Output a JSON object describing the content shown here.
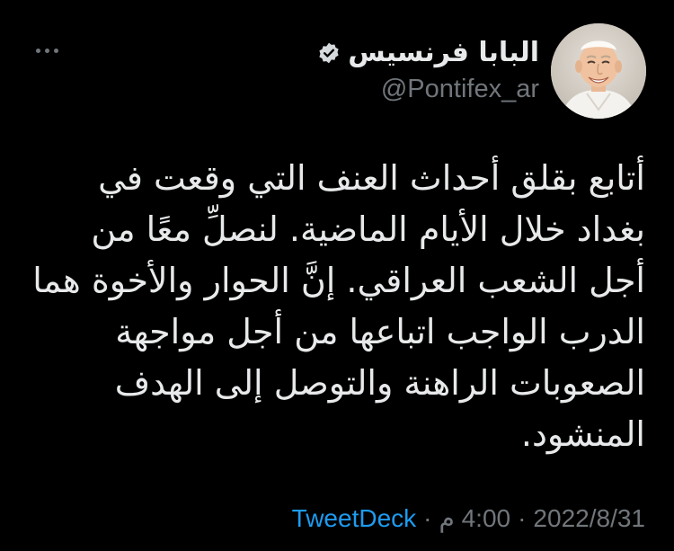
{
  "author": {
    "display_name": "البابا فرنسيس",
    "handle": "@Pontifex_ar",
    "verified": true
  },
  "tweet": {
    "text": "أتابع بقلق أحداث العنف التي وقعت في\nبغداد خلال الأيام الماضية. لنصلِّ معًا من\nأجل الشعب العراقي. إنَّ الحوار والأخوة هما\nالدرب الواجب اتباعها من أجل مواجهة\nالصعوبات الراهنة والتوصل إلى الهدف\nالمنشود."
  },
  "meta": {
    "date": "2022/8/31",
    "time": "4:00 م",
    "separator": "·",
    "source": "TweetDeck"
  },
  "icons": {
    "more": "more-horizontal-icon",
    "verified": "verified-badge-icon"
  },
  "colors": {
    "background": "#000000",
    "text": "#e7e9ea",
    "secondary": "#71767b",
    "link": "#1d9bf0"
  }
}
